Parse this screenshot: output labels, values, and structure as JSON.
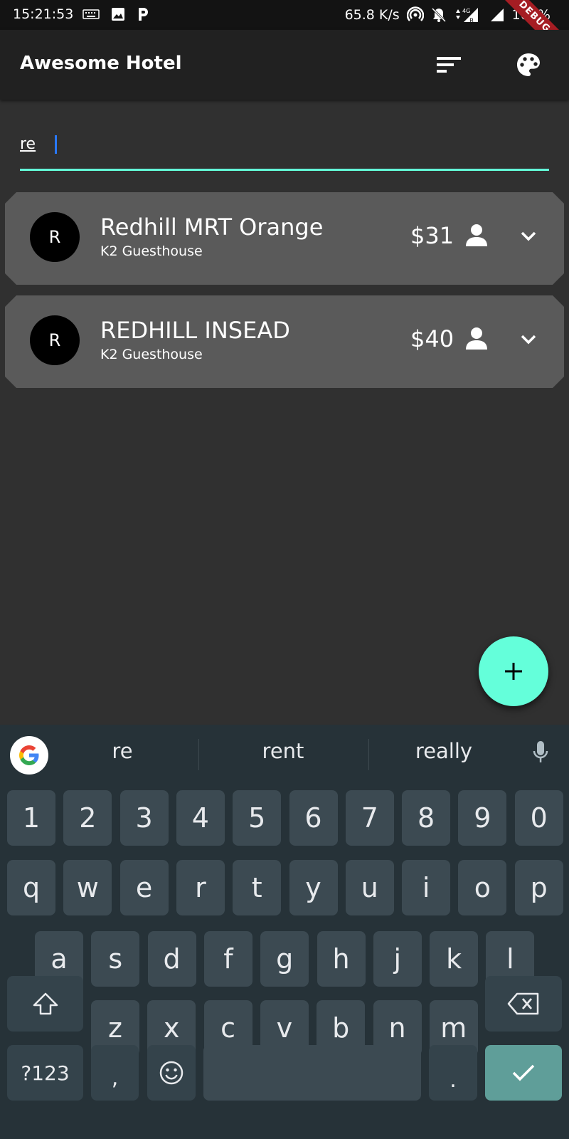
{
  "status_bar": {
    "time": "15:21:53",
    "net_speed": "65.8 K/s",
    "battery": "100%",
    "debug_label": "DEBUG",
    "icons": [
      "keyboard-icon",
      "image-icon",
      "parking-icon",
      "hotspot-icon",
      "mute-icon",
      "data-arrows-icon",
      "signal-4g-icon",
      "signal-icon",
      "battery-icon"
    ]
  },
  "app_bar": {
    "title": "Awesome Hotel",
    "actions": [
      "sort-icon",
      "palette-icon"
    ]
  },
  "search": {
    "value": "re"
  },
  "results": [
    {
      "avatar": "R",
      "title": "Redhill MRT Orange",
      "subtitle": "K2 Guesthouse",
      "price": "$31"
    },
    {
      "avatar": "R",
      "title": "REDHILL INSEAD",
      "subtitle": "K2 Guesthouse",
      "price": "$40"
    }
  ],
  "fab": {
    "icon": "plus-icon"
  },
  "keyboard": {
    "suggestions": [
      "re",
      "rent",
      "really"
    ],
    "rows": [
      [
        "1",
        "2",
        "3",
        "4",
        "5",
        "6",
        "7",
        "8",
        "9",
        "0"
      ],
      [
        "q",
        "w",
        "e",
        "r",
        "t",
        "y",
        "u",
        "i",
        "o",
        "p"
      ],
      [
        "a",
        "s",
        "d",
        "f",
        "g",
        "h",
        "j",
        "k",
        "l"
      ],
      [
        "z",
        "x",
        "c",
        "v",
        "b",
        "n",
        "m"
      ]
    ],
    "symbols_key": "?123",
    "comma_key": ",",
    "period_key": ".",
    "colors": {
      "background": "#263238",
      "key": "#3c4a52",
      "enter": "#5f9e99"
    }
  },
  "colors": {
    "accent": "#64ffda",
    "card": "#5a5a5a",
    "appbar": "#212121",
    "background": "#303030"
  }
}
